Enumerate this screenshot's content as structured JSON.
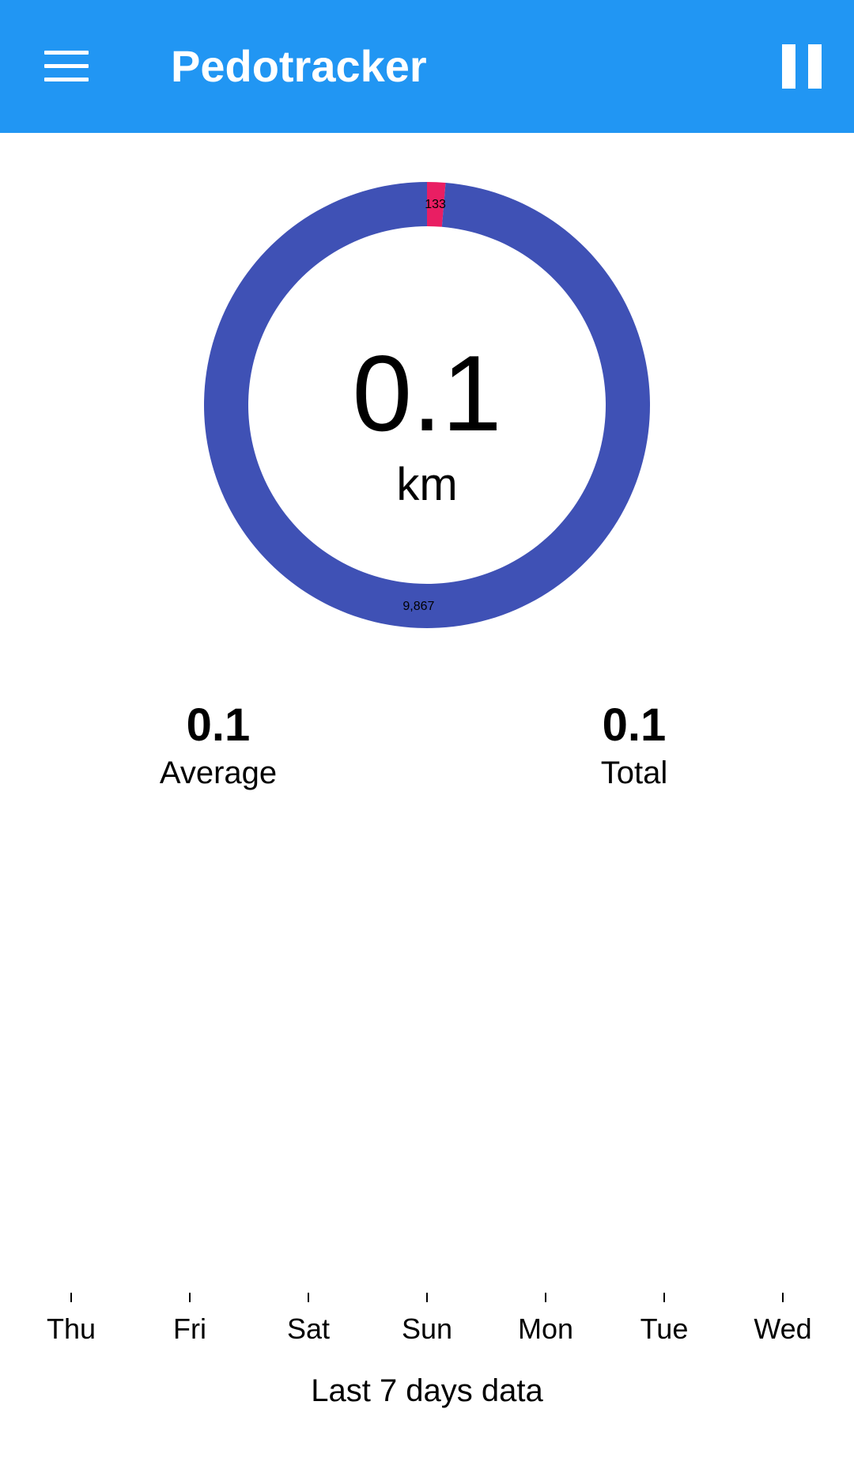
{
  "app_bar": {
    "title": "Pedotracker",
    "menu_icon": "hamburger-menu-icon",
    "pause_icon": "pause-icon",
    "color": "#2196f3"
  },
  "summary": {
    "distance_value": "0.1",
    "distance_unit": "km"
  },
  "stats": {
    "average_value": "0.1",
    "average_label": "Average",
    "total_value": "0.1",
    "total_label": "Total"
  },
  "chart_data": [
    {
      "type": "pie",
      "style": "donut",
      "slices": [
        {
          "value": 133,
          "label": "133",
          "color": "#e91e63"
        },
        {
          "value": 9867,
          "label": "9,867",
          "color": "#3f51b5"
        }
      ]
    },
    {
      "type": "bar",
      "categories": [
        "Thu",
        "Fri",
        "Sat",
        "Sun",
        "Mon",
        "Tue",
        "Wed"
      ],
      "values": [
        0,
        0,
        0,
        0,
        0,
        0,
        0
      ],
      "caption": "Last 7 days data"
    }
  ]
}
